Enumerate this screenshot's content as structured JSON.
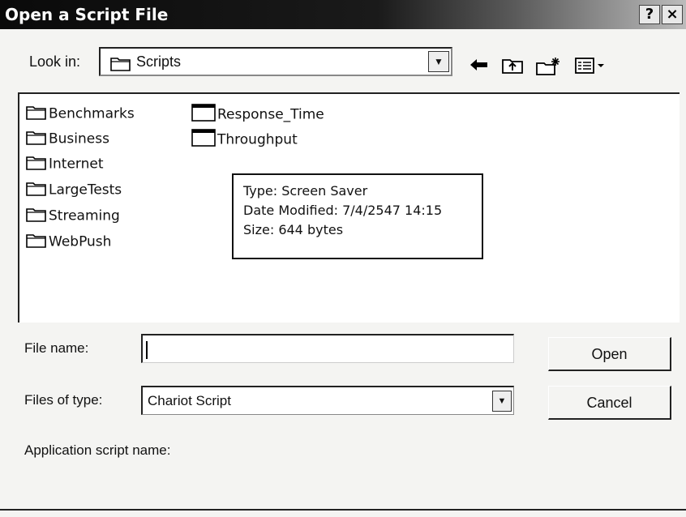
{
  "window": {
    "title": "Open a Script File",
    "help_label": "?",
    "close_label": "×"
  },
  "look_in": {
    "label": "Look in:",
    "value": "Scripts"
  },
  "toolbar": {
    "back_icon": "back-arrow-icon",
    "up_icon": "up-folder-icon",
    "new_folder_icon": "new-folder-icon",
    "view_icon": "view-menu-icon"
  },
  "folders": [
    {
      "label": "Benchmarks"
    },
    {
      "label": "Business"
    },
    {
      "label": "Internet"
    },
    {
      "label": "LargeTests"
    },
    {
      "label": "Streaming"
    },
    {
      "label": "WebPush"
    }
  ],
  "files": [
    {
      "label": "Response_Time"
    },
    {
      "label": "Throughput"
    }
  ],
  "tooltip": {
    "type": "Type: Screen Saver",
    "date": "Date Modified: 7/4/2547 14:15",
    "size": "Size: 644 bytes"
  },
  "form": {
    "file_name_label": "File name:",
    "file_name_value": "",
    "files_of_type_label": "Files of type:",
    "files_of_type_value": "Chariot Script",
    "app_script_label": "Application script name:"
  },
  "buttons": {
    "open": "Open",
    "cancel": "Cancel"
  }
}
